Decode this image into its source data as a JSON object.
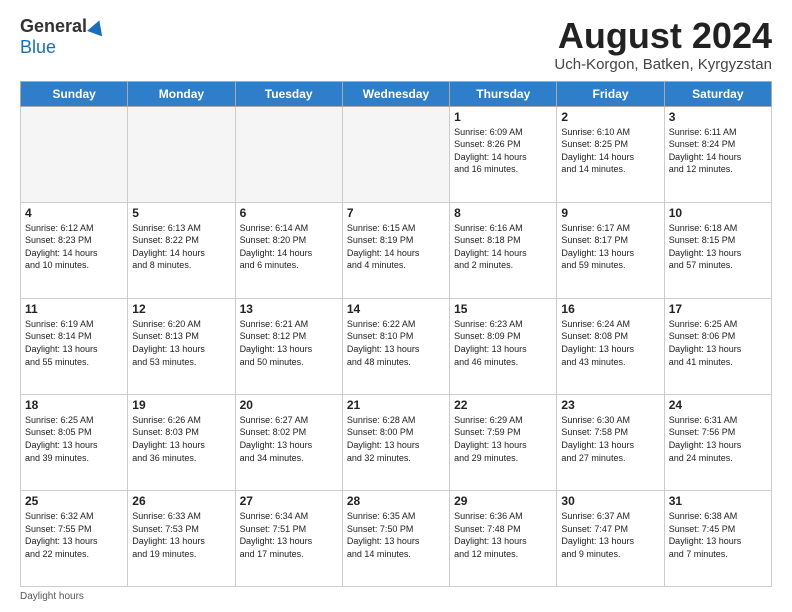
{
  "header": {
    "logo_general": "General",
    "logo_blue": "Blue",
    "title": "August 2024",
    "location": "Uch-Korgon, Batken, Kyrgyzstan"
  },
  "days_of_week": [
    "Sunday",
    "Monday",
    "Tuesday",
    "Wednesday",
    "Thursday",
    "Friday",
    "Saturday"
  ],
  "weeks": [
    [
      {
        "day": "",
        "info": ""
      },
      {
        "day": "",
        "info": ""
      },
      {
        "day": "",
        "info": ""
      },
      {
        "day": "",
        "info": ""
      },
      {
        "day": "1",
        "info": "Sunrise: 6:09 AM\nSunset: 8:26 PM\nDaylight: 14 hours\nand 16 minutes."
      },
      {
        "day": "2",
        "info": "Sunrise: 6:10 AM\nSunset: 8:25 PM\nDaylight: 14 hours\nand 14 minutes."
      },
      {
        "day": "3",
        "info": "Sunrise: 6:11 AM\nSunset: 8:24 PM\nDaylight: 14 hours\nand 12 minutes."
      }
    ],
    [
      {
        "day": "4",
        "info": "Sunrise: 6:12 AM\nSunset: 8:23 PM\nDaylight: 14 hours\nand 10 minutes."
      },
      {
        "day": "5",
        "info": "Sunrise: 6:13 AM\nSunset: 8:22 PM\nDaylight: 14 hours\nand 8 minutes."
      },
      {
        "day": "6",
        "info": "Sunrise: 6:14 AM\nSunset: 8:20 PM\nDaylight: 14 hours\nand 6 minutes."
      },
      {
        "day": "7",
        "info": "Sunrise: 6:15 AM\nSunset: 8:19 PM\nDaylight: 14 hours\nand 4 minutes."
      },
      {
        "day": "8",
        "info": "Sunrise: 6:16 AM\nSunset: 8:18 PM\nDaylight: 14 hours\nand 2 minutes."
      },
      {
        "day": "9",
        "info": "Sunrise: 6:17 AM\nSunset: 8:17 PM\nDaylight: 13 hours\nand 59 minutes."
      },
      {
        "day": "10",
        "info": "Sunrise: 6:18 AM\nSunset: 8:15 PM\nDaylight: 13 hours\nand 57 minutes."
      }
    ],
    [
      {
        "day": "11",
        "info": "Sunrise: 6:19 AM\nSunset: 8:14 PM\nDaylight: 13 hours\nand 55 minutes."
      },
      {
        "day": "12",
        "info": "Sunrise: 6:20 AM\nSunset: 8:13 PM\nDaylight: 13 hours\nand 53 minutes."
      },
      {
        "day": "13",
        "info": "Sunrise: 6:21 AM\nSunset: 8:12 PM\nDaylight: 13 hours\nand 50 minutes."
      },
      {
        "day": "14",
        "info": "Sunrise: 6:22 AM\nSunset: 8:10 PM\nDaylight: 13 hours\nand 48 minutes."
      },
      {
        "day": "15",
        "info": "Sunrise: 6:23 AM\nSunset: 8:09 PM\nDaylight: 13 hours\nand 46 minutes."
      },
      {
        "day": "16",
        "info": "Sunrise: 6:24 AM\nSunset: 8:08 PM\nDaylight: 13 hours\nand 43 minutes."
      },
      {
        "day": "17",
        "info": "Sunrise: 6:25 AM\nSunset: 8:06 PM\nDaylight: 13 hours\nand 41 minutes."
      }
    ],
    [
      {
        "day": "18",
        "info": "Sunrise: 6:25 AM\nSunset: 8:05 PM\nDaylight: 13 hours\nand 39 minutes."
      },
      {
        "day": "19",
        "info": "Sunrise: 6:26 AM\nSunset: 8:03 PM\nDaylight: 13 hours\nand 36 minutes."
      },
      {
        "day": "20",
        "info": "Sunrise: 6:27 AM\nSunset: 8:02 PM\nDaylight: 13 hours\nand 34 minutes."
      },
      {
        "day": "21",
        "info": "Sunrise: 6:28 AM\nSunset: 8:00 PM\nDaylight: 13 hours\nand 32 minutes."
      },
      {
        "day": "22",
        "info": "Sunrise: 6:29 AM\nSunset: 7:59 PM\nDaylight: 13 hours\nand 29 minutes."
      },
      {
        "day": "23",
        "info": "Sunrise: 6:30 AM\nSunset: 7:58 PM\nDaylight: 13 hours\nand 27 minutes."
      },
      {
        "day": "24",
        "info": "Sunrise: 6:31 AM\nSunset: 7:56 PM\nDaylight: 13 hours\nand 24 minutes."
      }
    ],
    [
      {
        "day": "25",
        "info": "Sunrise: 6:32 AM\nSunset: 7:55 PM\nDaylight: 13 hours\nand 22 minutes."
      },
      {
        "day": "26",
        "info": "Sunrise: 6:33 AM\nSunset: 7:53 PM\nDaylight: 13 hours\nand 19 minutes."
      },
      {
        "day": "27",
        "info": "Sunrise: 6:34 AM\nSunset: 7:51 PM\nDaylight: 13 hours\nand 17 minutes."
      },
      {
        "day": "28",
        "info": "Sunrise: 6:35 AM\nSunset: 7:50 PM\nDaylight: 13 hours\nand 14 minutes."
      },
      {
        "day": "29",
        "info": "Sunrise: 6:36 AM\nSunset: 7:48 PM\nDaylight: 13 hours\nand 12 minutes."
      },
      {
        "day": "30",
        "info": "Sunrise: 6:37 AM\nSunset: 7:47 PM\nDaylight: 13 hours\nand 9 minutes."
      },
      {
        "day": "31",
        "info": "Sunrise: 6:38 AM\nSunset: 7:45 PM\nDaylight: 13 hours\nand 7 minutes."
      }
    ]
  ],
  "footer": {
    "note": "Daylight hours"
  }
}
